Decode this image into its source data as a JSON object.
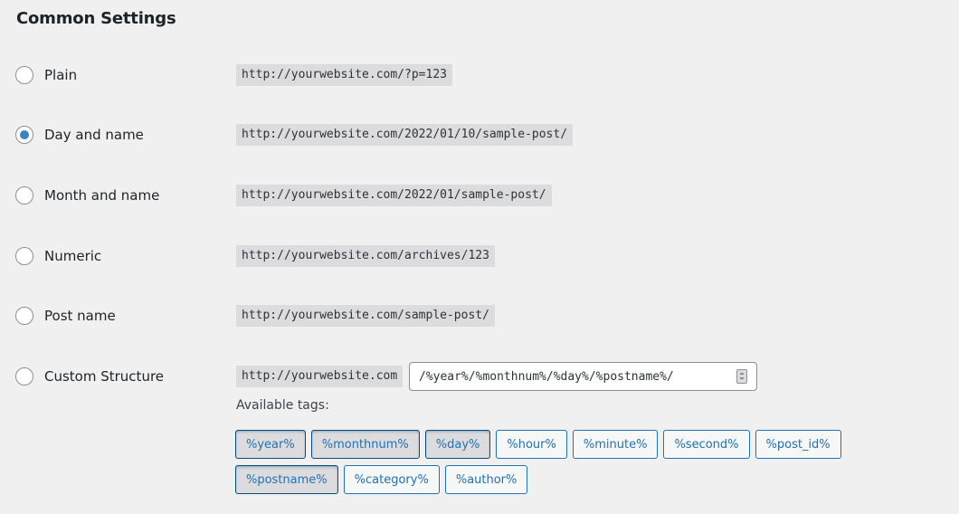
{
  "section": {
    "title": "Common Settings"
  },
  "options": [
    {
      "label": "Plain",
      "example": "http://yourwebsite.com/?p=123",
      "checked": false
    },
    {
      "label": "Day and name",
      "example": "http://yourwebsite.com/2022/01/10/sample-post/",
      "checked": true
    },
    {
      "label": "Month and name",
      "example": "http://yourwebsite.com/2022/01/sample-post/",
      "checked": false
    },
    {
      "label": "Numeric",
      "example": "http://yourwebsite.com/archives/123",
      "checked": false
    },
    {
      "label": "Post name",
      "example": "http://yourwebsite.com/sample-post/",
      "checked": false
    },
    {
      "label": "Custom Structure",
      "example": "http://yourwebsite.com",
      "checked": false
    }
  ],
  "custom": {
    "value": "/%year%/%monthnum%/%day%/%postname%/",
    "icon": "contact-card-icon"
  },
  "available_tags": {
    "label": "Available tags:",
    "tags": [
      {
        "label": "%year%",
        "active": true
      },
      {
        "label": "%monthnum%",
        "active": true
      },
      {
        "label": "%day%",
        "active": true
      },
      {
        "label": "%hour%",
        "active": false
      },
      {
        "label": "%minute%",
        "active": false
      },
      {
        "label": "%second%",
        "active": false
      },
      {
        "label": "%post_id%",
        "active": false
      },
      {
        "label": "%postname%",
        "active": true
      },
      {
        "label": "%category%",
        "active": false
      },
      {
        "label": "%author%",
        "active": false
      }
    ]
  }
}
